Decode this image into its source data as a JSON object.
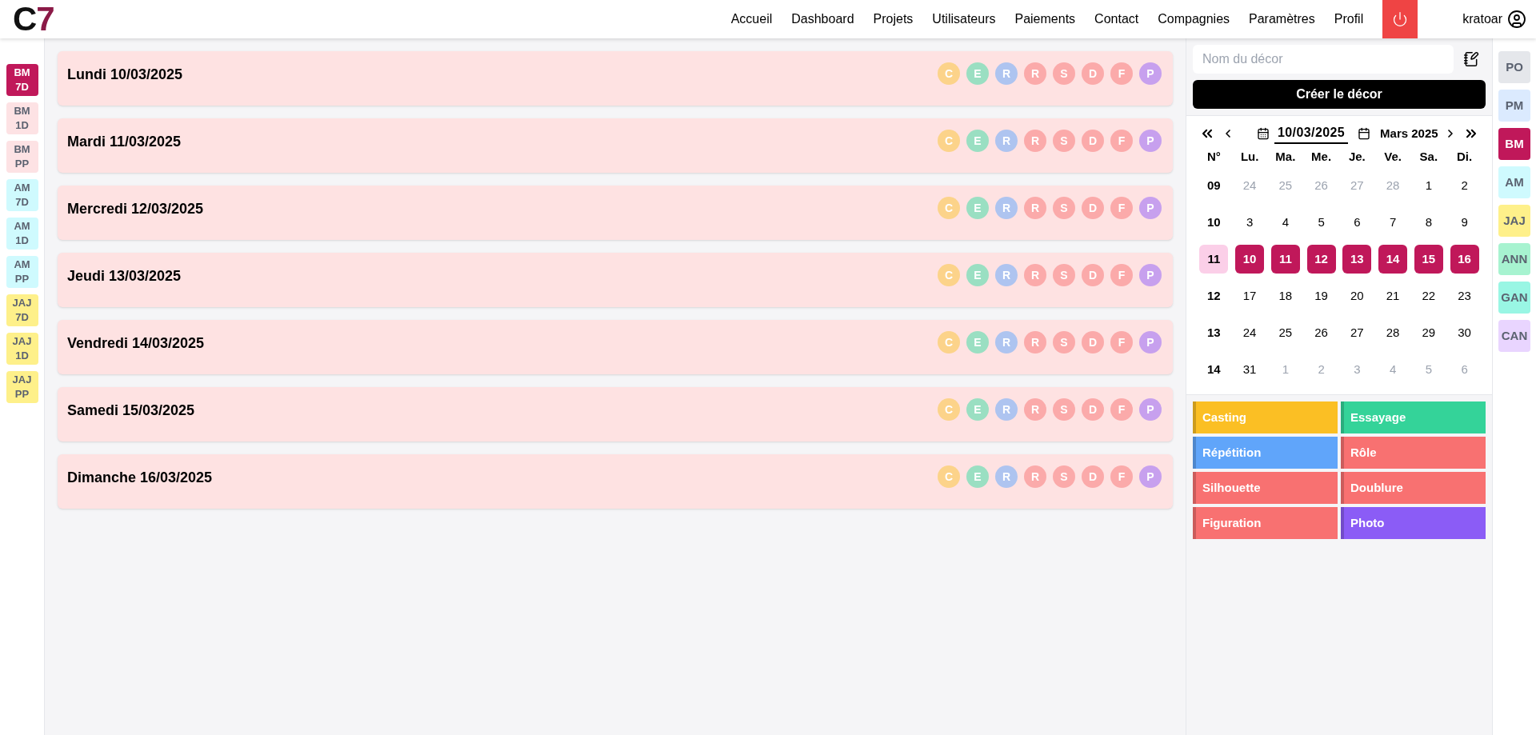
{
  "header": {
    "logo": [
      {
        "text": "C",
        "color": "#111111"
      },
      {
        "text": "7",
        "color": "#8b1a47"
      }
    ],
    "nav": [
      "Accueil",
      "Dashboard",
      "Projets",
      "Utilisateurs",
      "Paiements",
      "Contact",
      "Compagnies",
      "Paramètres",
      "Profil"
    ],
    "user": "kratoar"
  },
  "left_sidebar": [
    {
      "label": "BM 7D",
      "selected": true
    },
    {
      "label": "BM 1D",
      "color": "#fde2e4",
      "selected": false
    },
    {
      "label": "BM PP",
      "color": "#fde2e4",
      "selected": false
    },
    {
      "label": "AM 7D",
      "color": "#cffafe",
      "selected": false
    },
    {
      "label": "AM 1D",
      "color": "#cffafe",
      "selected": false
    },
    {
      "label": "AM PP",
      "color": "#cffafe",
      "selected": false
    },
    {
      "label": "JAJ 7D",
      "color": "#fef08a",
      "selected": false
    },
    {
      "label": "JAJ 1D",
      "color": "#fef08a",
      "selected": false
    },
    {
      "label": "JAJ PP",
      "color": "#fef08a",
      "selected": false
    }
  ],
  "days": [
    {
      "title": "Lundi 10/03/2025",
      "markers": [
        {
          "label": "C",
          "color": "#fcd38a"
        },
        {
          "label": "E",
          "color": "#9adfc2"
        },
        {
          "label": "R",
          "color": "#aec4f0"
        },
        {
          "label": "R",
          "color": "#fbaaaa"
        },
        {
          "label": "S",
          "color": "#fbaaaa"
        },
        {
          "label": "D",
          "color": "#fbaaaa"
        },
        {
          "label": "F",
          "color": "#fbaaaa"
        },
        {
          "label": "P",
          "color": "#c7a0ee"
        }
      ]
    },
    {
      "title": "Mardi 11/03/2025",
      "markers": [
        {
          "label": "C",
          "color": "#fcd38a"
        },
        {
          "label": "E",
          "color": "#9adfc2"
        },
        {
          "label": "R",
          "color": "#aec4f0"
        },
        {
          "label": "R",
          "color": "#fbaaaa"
        },
        {
          "label": "S",
          "color": "#fbaaaa"
        },
        {
          "label": "D",
          "color": "#fbaaaa"
        },
        {
          "label": "F",
          "color": "#fbaaaa"
        },
        {
          "label": "P",
          "color": "#c7a0ee"
        }
      ]
    },
    {
      "title": "Mercredi 12/03/2025",
      "markers": [
        {
          "label": "C",
          "color": "#fcd38a"
        },
        {
          "label": "E",
          "color": "#9adfc2"
        },
        {
          "label": "R",
          "color": "#aec4f0"
        },
        {
          "label": "R",
          "color": "#fbaaaa"
        },
        {
          "label": "S",
          "color": "#fbaaaa"
        },
        {
          "label": "D",
          "color": "#fbaaaa"
        },
        {
          "label": "F",
          "color": "#fbaaaa"
        },
        {
          "label": "P",
          "color": "#c7a0ee"
        }
      ]
    },
    {
      "title": "Jeudi 13/03/2025",
      "markers": [
        {
          "label": "C",
          "color": "#fcd38a"
        },
        {
          "label": "E",
          "color": "#9adfc2"
        },
        {
          "label": "R",
          "color": "#aec4f0"
        },
        {
          "label": "R",
          "color": "#fbaaaa"
        },
        {
          "label": "S",
          "color": "#fbaaaa"
        },
        {
          "label": "D",
          "color": "#fbaaaa"
        },
        {
          "label": "F",
          "color": "#fbaaaa"
        },
        {
          "label": "P",
          "color": "#c7a0ee"
        }
      ]
    },
    {
      "title": "Vendredi 14/03/2025",
      "markers": [
        {
          "label": "C",
          "color": "#fcd38a"
        },
        {
          "label": "E",
          "color": "#9adfc2"
        },
        {
          "label": "R",
          "color": "#aec4f0"
        },
        {
          "label": "R",
          "color": "#fbaaaa"
        },
        {
          "label": "S",
          "color": "#fbaaaa"
        },
        {
          "label": "D",
          "color": "#fbaaaa"
        },
        {
          "label": "F",
          "color": "#fbaaaa"
        },
        {
          "label": "P",
          "color": "#c7a0ee"
        }
      ]
    },
    {
      "title": "Samedi 15/03/2025",
      "markers": [
        {
          "label": "C",
          "color": "#fcd38a"
        },
        {
          "label": "E",
          "color": "#9adfc2"
        },
        {
          "label": "R",
          "color": "#aec4f0"
        },
        {
          "label": "R",
          "color": "#fbaaaa"
        },
        {
          "label": "S",
          "color": "#fbaaaa"
        },
        {
          "label": "D",
          "color": "#fbaaaa"
        },
        {
          "label": "F",
          "color": "#fbaaaa"
        },
        {
          "label": "P",
          "color": "#c7a0ee"
        }
      ]
    },
    {
      "title": "Dimanche 16/03/2025",
      "markers": [
        {
          "label": "C",
          "color": "#fcd38a"
        },
        {
          "label": "E",
          "color": "#9adfc2"
        },
        {
          "label": "R",
          "color": "#aec4f0"
        },
        {
          "label": "R",
          "color": "#fbaaaa"
        },
        {
          "label": "S",
          "color": "#fbaaaa"
        },
        {
          "label": "D",
          "color": "#fbaaaa"
        },
        {
          "label": "F",
          "color": "#fbaaaa"
        },
        {
          "label": "P",
          "color": "#c7a0ee"
        }
      ]
    }
  ],
  "decor": {
    "placeholder": "Nom du décor",
    "button": "Créer le décor"
  },
  "calendar": {
    "date": "10/03/2025",
    "month": "Mars 2025",
    "headers": [
      "N°",
      "Lu.",
      "Ma.",
      "Me.",
      "Je.",
      "Ve.",
      "Sa.",
      "Di."
    ],
    "weeks": [
      {
        "number": "09",
        "highlighted": false,
        "days": [
          {
            "label": "24",
            "muted": true,
            "selected": false
          },
          {
            "label": "25",
            "muted": true,
            "selected": false
          },
          {
            "label": "26",
            "muted": true,
            "selected": false
          },
          {
            "label": "27",
            "muted": true,
            "selected": false
          },
          {
            "label": "28",
            "muted": true,
            "selected": false
          },
          {
            "label": "1",
            "muted": false,
            "selected": false
          },
          {
            "label": "2",
            "muted": false,
            "selected": false
          }
        ]
      },
      {
        "number": "10",
        "highlighted": false,
        "days": [
          {
            "label": "3",
            "muted": false,
            "selected": false
          },
          {
            "label": "4",
            "muted": false,
            "selected": false
          },
          {
            "label": "5",
            "muted": false,
            "selected": false
          },
          {
            "label": "6",
            "muted": false,
            "selected": false
          },
          {
            "label": "7",
            "muted": false,
            "selected": false
          },
          {
            "label": "8",
            "muted": false,
            "selected": false
          },
          {
            "label": "9",
            "muted": false,
            "selected": false
          }
        ]
      },
      {
        "number": "11",
        "highlighted": true,
        "days": [
          {
            "label": "10",
            "muted": false,
            "selected": true
          },
          {
            "label": "11",
            "muted": false,
            "selected": true
          },
          {
            "label": "12",
            "muted": false,
            "selected": true
          },
          {
            "label": "13",
            "muted": false,
            "selected": true
          },
          {
            "label": "14",
            "muted": false,
            "selected": true
          },
          {
            "label": "15",
            "muted": false,
            "selected": true
          },
          {
            "label": "16",
            "muted": false,
            "selected": true
          }
        ]
      },
      {
        "number": "12",
        "highlighted": false,
        "days": [
          {
            "label": "17",
            "muted": false,
            "selected": false
          },
          {
            "label": "18",
            "muted": false,
            "selected": false
          },
          {
            "label": "19",
            "muted": false,
            "selected": false
          },
          {
            "label": "20",
            "muted": false,
            "selected": false
          },
          {
            "label": "21",
            "muted": false,
            "selected": false
          },
          {
            "label": "22",
            "muted": false,
            "selected": false
          },
          {
            "label": "23",
            "muted": false,
            "selected": false
          }
        ]
      },
      {
        "number": "13",
        "highlighted": false,
        "days": [
          {
            "label": "24",
            "muted": false,
            "selected": false
          },
          {
            "label": "25",
            "muted": false,
            "selected": false
          },
          {
            "label": "26",
            "muted": false,
            "selected": false
          },
          {
            "label": "27",
            "muted": false,
            "selected": false
          },
          {
            "label": "28",
            "muted": false,
            "selected": false
          },
          {
            "label": "29",
            "muted": false,
            "selected": false
          },
          {
            "label": "30",
            "muted": false,
            "selected": false
          }
        ]
      },
      {
        "number": "14",
        "highlighted": false,
        "days": [
          {
            "label": "31",
            "muted": false,
            "selected": false
          },
          {
            "label": "1",
            "muted": true,
            "selected": false
          },
          {
            "label": "2",
            "muted": true,
            "selected": false
          },
          {
            "label": "3",
            "muted": true,
            "selected": false
          },
          {
            "label": "4",
            "muted": true,
            "selected": false
          },
          {
            "label": "5",
            "muted": true,
            "selected": false
          },
          {
            "label": "6",
            "muted": true,
            "selected": false
          }
        ]
      }
    ]
  },
  "legend": [
    {
      "label": "Casting",
      "color": "#fbbf24"
    },
    {
      "label": "Essayage",
      "color": "#34d399"
    },
    {
      "label": "Répétition",
      "color": "#60a5fa"
    },
    {
      "label": "Rôle",
      "color": "#f87171"
    },
    {
      "label": "Silhouette",
      "color": "#f87171"
    },
    {
      "label": "Doublure",
      "color": "#f87171"
    },
    {
      "label": "Figuration",
      "color": "#f87171"
    },
    {
      "label": "Photo",
      "color": "#8b5cf6"
    }
  ],
  "right_sidebar": [
    {
      "label": "PO",
      "color": "#e5e7eb",
      "selected": false
    },
    {
      "label": "PM",
      "color": "#dbeafe",
      "selected": false
    },
    {
      "label": "BM",
      "selected": true
    },
    {
      "label": "AM",
      "color": "#cffafe",
      "selected": false
    },
    {
      "label": "JAJ",
      "color": "#fef08a",
      "selected": false
    },
    {
      "label": "ANN",
      "color": "#a7f3d0",
      "selected": false
    },
    {
      "label": "GAN",
      "color": "#99f6e4",
      "selected": false
    },
    {
      "label": "CAN",
      "color": "#e9d5ff",
      "selected": false
    }
  ]
}
